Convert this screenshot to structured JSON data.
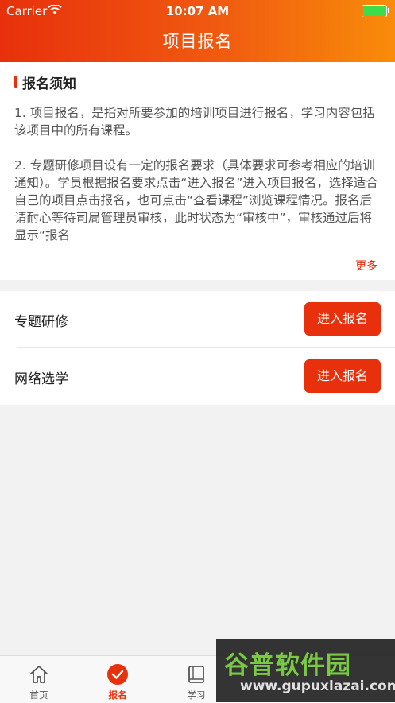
{
  "status_bar": {
    "carrier": "Carrier",
    "time": "10:07 AM"
  },
  "header": {
    "title": "项目报名"
  },
  "notice": {
    "title": "报名须知",
    "paragraphs": [
      "1. 项目报名，是指对所要参加的培训项目进行报名，学习内容包括该项目中的所有课程。",
      "2. 专题研修项目设有一定的报名要求（具体要求可参考相应的培训通知）。学员根据报名要求点击“进入报名”进入项目报名，选择适合自己的项目点击报名，也可点击“查看课程”浏览课程情况。报名后请耐心等待司局管理员审核，此时状态为“审核中”，审核通过后将显示“报名"
    ],
    "more_label": "更多"
  },
  "list": {
    "rows": [
      {
        "label": "专题研修",
        "button": "进入报名"
      },
      {
        "label": "网络选学",
        "button": "进入报名"
      }
    ]
  },
  "tabbar": {
    "tabs": [
      {
        "label": "首页",
        "icon": "home-icon"
      },
      {
        "label": "报名",
        "icon": "check-circle-icon",
        "active": true
      },
      {
        "label": "学习",
        "icon": "book-icon"
      }
    ]
  },
  "watermark": {
    "text": "谷普软件园",
    "url": "www.gupuxlazai.com"
  },
  "colors": {
    "accent": "#e8300c",
    "header_end": "#f98c0a"
  }
}
